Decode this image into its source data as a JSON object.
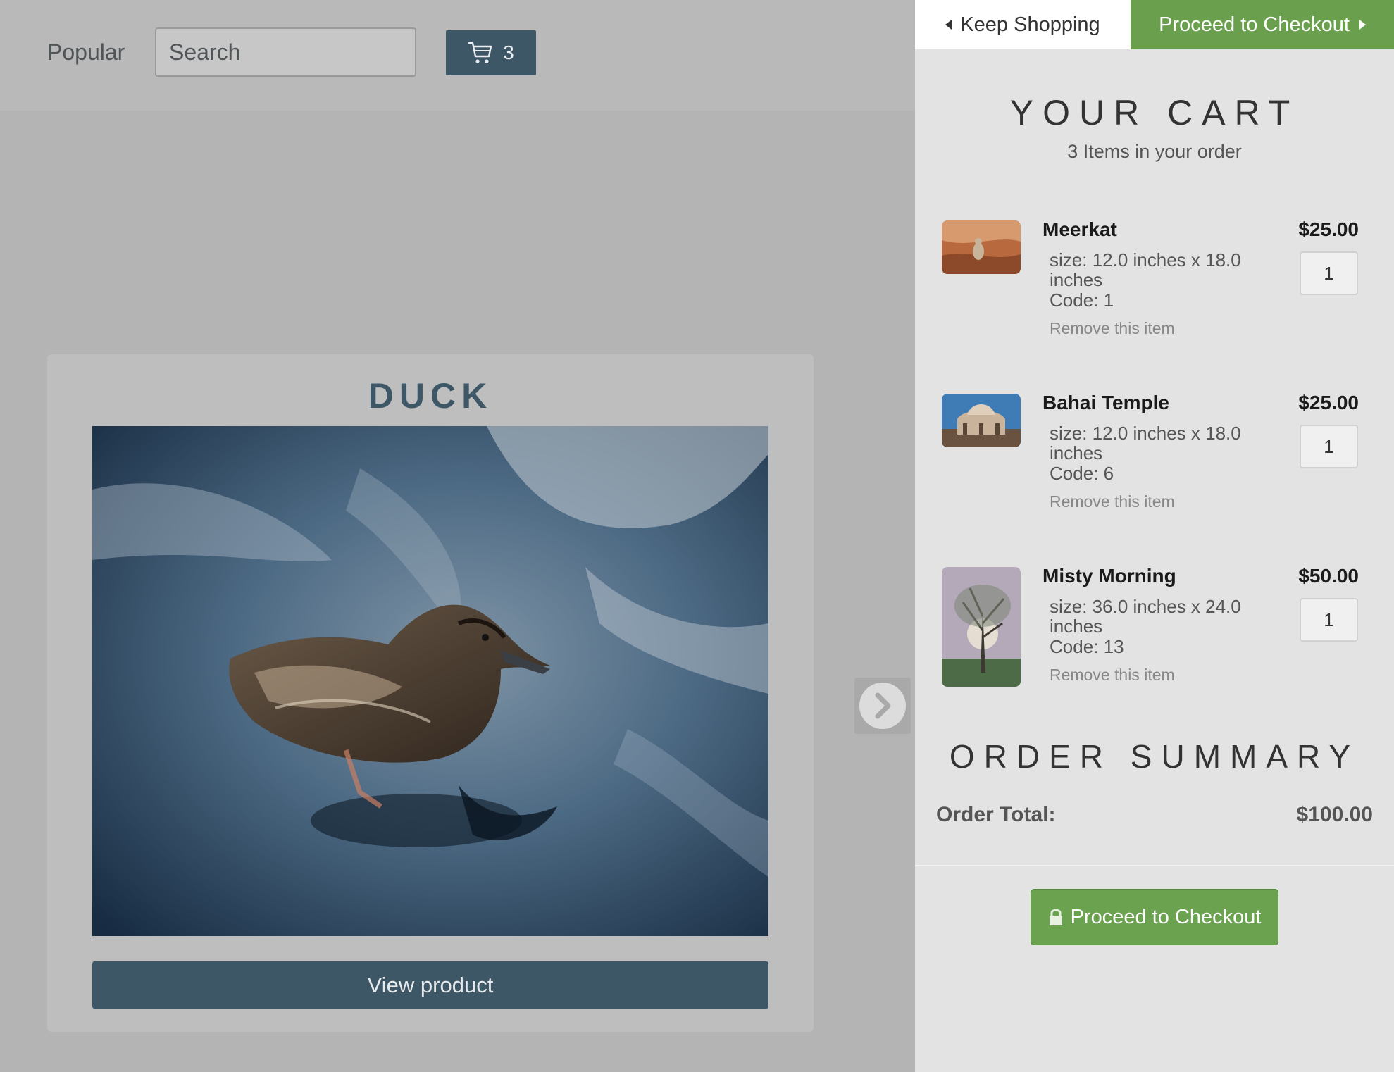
{
  "header": {
    "nav_popular": "Popular",
    "search_placeholder": "Search",
    "cart_count": "3"
  },
  "product": {
    "title": "DUCK",
    "view_button": "View product"
  },
  "cart": {
    "keep_shopping": "Keep Shopping",
    "checkout_top": "Proceed to Checkout",
    "title": "YOUR CART",
    "subtitle": "3 Items in your order",
    "items": [
      {
        "name": "Meerkat",
        "price": "$25.00",
        "size": "size: 12.0 inches x 18.0 inches",
        "code": "Code: 1",
        "remove": "Remove this item",
        "qty": "1",
        "thumb_icon": "meerkat-thumbnail"
      },
      {
        "name": "Bahai Temple",
        "price": "$25.00",
        "size": "size: 12.0 inches x 18.0 inches",
        "code": "Code: 6",
        "remove": "Remove this item",
        "qty": "1",
        "thumb_icon": "temple-thumbnail"
      },
      {
        "name": "Misty Morning",
        "price": "$50.00",
        "size": "size: 36.0 inches x 24.0 inches",
        "code": "Code: 13",
        "remove": "Remove this item",
        "qty": "1",
        "thumb_icon": "tree-thumbnail"
      }
    ],
    "summary_title": "ORDER SUMMARY",
    "total_label": "Order Total:",
    "total_value": "$100.00",
    "checkout_bottom": "Proceed to Checkout"
  },
  "colors": {
    "brand_dark": "#3e5766",
    "checkout_green": "#6a9f4e",
    "panel_bg": "#e3e3e3",
    "overlay_bg": "#b4b4b4"
  }
}
